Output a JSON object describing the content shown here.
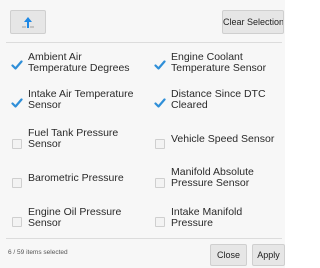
{
  "toolbar": {
    "sort_icon": "sort-arrow-icon",
    "clear_label": "Clear Selection"
  },
  "items": [
    {
      "label_1": "Ambient Air",
      "label_2": "Temperature Degrees",
      "checked": true
    },
    {
      "label_1": "Engine Coolant",
      "label_2": "Temperature Sensor",
      "checked": true
    },
    {
      "label_1": "Intake Air Temperature",
      "label_2": "Sensor",
      "checked": true
    },
    {
      "label_1": "Distance Since DTC",
      "label_2": "Cleared",
      "checked": true
    },
    {
      "label_1": "Fuel Tank Pressure",
      "label_2": "Sensor",
      "checked": false
    },
    {
      "label_1": "Vehicle Speed Sensor",
      "label_2": "",
      "checked": false
    },
    {
      "label_1": "Barometric Pressure",
      "label_2": "",
      "checked": false
    },
    {
      "label_1": "Manifold Absolute",
      "label_2": "Pressure Sensor",
      "checked": false
    },
    {
      "label_1": "Engine Oil Pressure",
      "label_2": "Sensor",
      "checked": false
    },
    {
      "label_1": "Intake Manifold",
      "label_2": "Pressure",
      "checked": false
    }
  ],
  "footer": {
    "count_text": "6 / 59 items selected",
    "close_label": "Close",
    "apply_label": "Apply"
  },
  "colors": {
    "check_blue": "#2f8fd8",
    "panel_bg": "#f7f7f7",
    "button_bg": "#e6e6e6"
  }
}
